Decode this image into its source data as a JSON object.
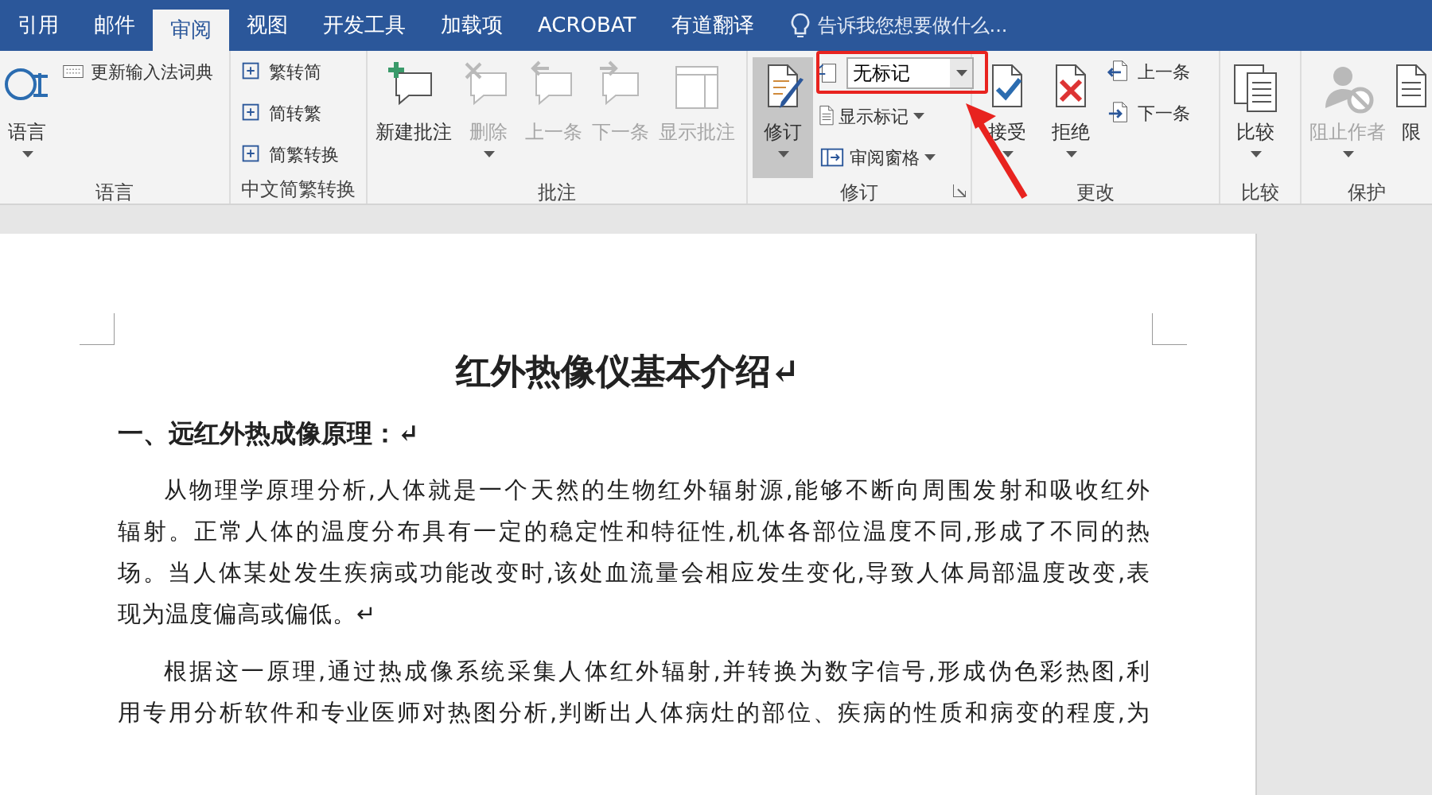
{
  "tabs": [
    {
      "label": "引用",
      "selected": false
    },
    {
      "label": "邮件",
      "selected": false
    },
    {
      "label": "审阅",
      "selected": true
    },
    {
      "label": "视图",
      "selected": false
    },
    {
      "label": "开发工具",
      "selected": false
    },
    {
      "label": "加载项",
      "selected": false
    },
    {
      "label": "ACROBAT",
      "selected": false
    },
    {
      "label": "有道翻译",
      "selected": false
    }
  ],
  "tell_me": {
    "placeholder": "告诉我您想要做什么..."
  },
  "ribbon_groups": [
    {
      "label": "语言",
      "controls": [
        {
          "kind": "large",
          "label": "语言",
          "disabled": false,
          "caret": true,
          "pressed": false
        },
        {
          "kind": "small",
          "label": "更新输入法词典",
          "disabled": false,
          "caret": false
        }
      ]
    },
    {
      "label": "中文简繁转换",
      "controls": [
        {
          "kind": "small",
          "label": "繁转简",
          "disabled": false,
          "caret": false
        },
        {
          "kind": "small",
          "label": "简转繁",
          "disabled": false,
          "caret": false
        },
        {
          "kind": "small",
          "label": "简繁转换",
          "disabled": false,
          "caret": false
        }
      ]
    },
    {
      "label": "批注",
      "controls": [
        {
          "kind": "large",
          "label": "新建批注",
          "disabled": false,
          "caret": false,
          "pressed": false
        },
        {
          "kind": "large",
          "label": "删除",
          "disabled": true,
          "caret": true,
          "pressed": false
        },
        {
          "kind": "large",
          "label": "上一条",
          "disabled": true,
          "caret": false,
          "pressed": false
        },
        {
          "kind": "large",
          "label": "下一条",
          "disabled": true,
          "caret": false,
          "pressed": false
        },
        {
          "kind": "large",
          "label": "显示批注",
          "disabled": true,
          "caret": false,
          "pressed": false
        }
      ]
    },
    {
      "label": "修订",
      "launcher": true,
      "controls": [
        {
          "kind": "large",
          "label": "修订",
          "disabled": false,
          "caret": true,
          "pressed": true
        },
        {
          "kind": "dropdown",
          "value": "无标记",
          "disabled": false,
          "caret": true
        },
        {
          "kind": "small",
          "label": "显示标记",
          "disabled": false,
          "caret": true
        },
        {
          "kind": "small",
          "label": "审阅窗格",
          "disabled": false,
          "caret": true
        }
      ]
    },
    {
      "label": "更改",
      "controls": [
        {
          "kind": "large",
          "label": "接受",
          "disabled": false,
          "caret": true,
          "pressed": false
        },
        {
          "kind": "large",
          "label": "拒绝",
          "disabled": false,
          "caret": true,
          "pressed": false
        },
        {
          "kind": "small",
          "label": "上一条",
          "disabled": false,
          "caret": false
        },
        {
          "kind": "small",
          "label": "下一条",
          "disabled": false,
          "caret": false
        }
      ]
    },
    {
      "label": "比较",
      "controls": [
        {
          "kind": "large",
          "label": "比较",
          "disabled": false,
          "caret": true,
          "pressed": false
        }
      ]
    },
    {
      "label": "保护",
      "controls": [
        {
          "kind": "large",
          "label": "阻止作者",
          "disabled": true,
          "caret": true,
          "pressed": false
        },
        {
          "kind": "large",
          "label": "限",
          "disabled": false,
          "caret": false,
          "pressed": false
        }
      ]
    }
  ],
  "document": {
    "title": "红外热像仪基本介绍↵",
    "heading": "一、远红外热成像原理：↵",
    "paragraphs": [
      {
        "lines": [
          "从物理学原理分析,人体就是一个天然的生物红外辐射源,能够不断向周围发射和吸收红外",
          "辐射。正常人体的温度分布具有一定的稳定性和特征性,机体各部位温度不同,形成了不同的热",
          "场。当人体某处发生疾病或功能改变时,该处血流量会相应发生变化,导致人体局部温度改变,表",
          "现为温度偏高或偏低。↵"
        ]
      },
      {
        "lines": [
          "根据这一原理,通过热成像系统采集人体红外辐射,并转换为数字信号,形成伪色彩热图,利",
          "用专用分析软件和专业医师对热图分析,判断出人体病灶的部位、疾病的性质和病变的程度,为"
        ]
      }
    ]
  }
}
